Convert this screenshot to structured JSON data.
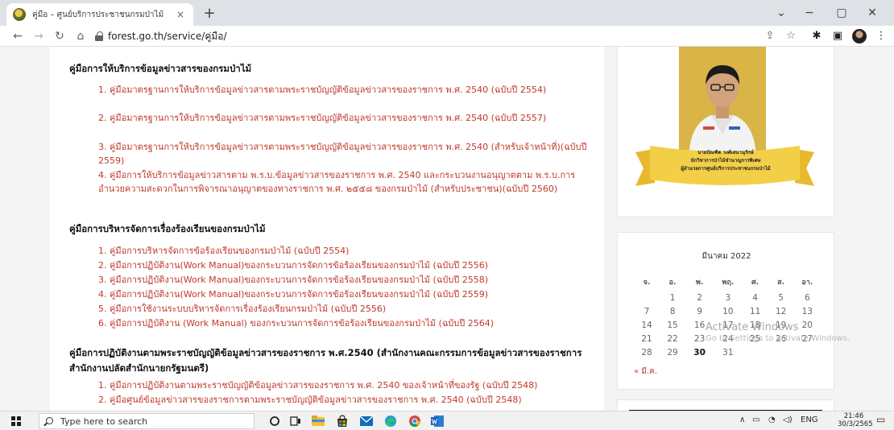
{
  "browser": {
    "tab_title": "คู่มือ – ศูนย์บริการประชาชนกรมป่าไม้",
    "tab_close": "×",
    "new_tab": "+",
    "win_min": "−",
    "win_max": "▢",
    "win_close": "✕",
    "win_chevron": "⌄",
    "back": "←",
    "forward": "→",
    "reload": "↻",
    "home": "⌂",
    "url": "forest.go.th/service/คู่มือ/",
    "share": "⇪",
    "star": "☆",
    "extensions": "✱",
    "sidepanel": "▣",
    "menu": "⋮"
  },
  "content": {
    "sections": [
      {
        "title": "คู่มือการให้บริการข้อมูลข่าวสารของกรมป่าไม้",
        "items": [
          "1. คู่มือมาตรฐานการให้บริการข้อมูลข่าวสารตามพระราชบัญญัติข้อมูลข่าวสารของราชการ พ.ศ. 2540 (ฉบับปี 2554)",
          "2. คู่มือมาตรฐานการให้บริการข้อมูลข่าวสารตามพระราชบัญญัติข้อมูลข่าวสารของราชการ พ.ศ. 2540 (ฉบับปี 2557)",
          "3. คู่มือมาตรฐานการให้บริการข้อมูลข่าวสารตามพระราชบัญญัติข้อมูลข่าวสารของราชการ พ.ศ. 2540 (สำหรับเจ้าหน้าที่)(ฉบับปี 2559)",
          "4. คู่มือการให้บริการข้อมูลข่าวสารตาม พ.ร.บ.ข้อมูลข่าวสารของราชการ พ.ศ. 2540 และกระบวนงานอนุญาตตาม พ.ร.บ.การอำนวยความสะดวกในการพิจารณาอนุญาตของทางราชการ พ.ศ. ๒๕๕๘ ของกรมป่าไม้ (สำหรับประชาชน)(ฉบับปี 2560)"
        ]
      },
      {
        "title": "คู่มือการบริหารจัดการเรื่องร้องเรียนของกรมป่าไม้",
        "items": [
          "1. คู่มือการบริหารจัดการข้อร้องเรียนของกรมป่าไม้ (ฉบับปี 2554)",
          "2. คู่มือการปฏิบัติงาน(Work Manual)ของกระบวนการจัดการข้อร้องเรียนของกรมป่าไม้ (ฉบับปี 2556)",
          "3. คู่มือการปฏิบัติงาน(Work Manual)ของกระบวนการจัดการข้อร้องเรียนของกรมป่าไม้ (ฉบับปี 2558)",
          "4. คู่มือการปฏิบัติงาน(Work Manual)ของกระบวนการจัดการข้อร้องเรียนของกรมป่าไม้ (ฉบับปี 2559)",
          "5. คู่มือการใช้งานระบบบริหารจัดการเรื่องร้องเรียนกรมป่าไม้ (ฉบับปี 2556)",
          "6. คู่มือการปฏิบัติงาน (Work Manual) ของกระบวนการจัดการข้อร้องเรียนของกรมป่าไม้ (ฉบับปี 2564)"
        ]
      },
      {
        "title": "คู่มือการปฏิบัติงานตามพระราชบัญญัติข้อมูลข่าวสารของราชการ พ.ศ.2540 (สำนักงานคณะกรรมการข้อมูลข่าวสารของราชการ สำนักงานปลัดสำนักนายกรัฐมนตรี)",
        "items": [
          "1. คู่มือการปฏิบัติงานตามพระราชบัญญัติข้อมูลข่าวสารของราชการ พ.ศ. 2540 ของเจ้าหน้าที่ของรัฐ (ฉบับปี 2548)",
          "2. คู่มือศูนย์ข้อมูลข่าวสารของราชการตามพระราชบัญญัติข้อมูลข่าวสารของราชการ พ.ศ. 2540 (ฉบับปี 2548)"
        ]
      }
    ]
  },
  "sidebar": {
    "person": {
      "name": "นายบัณฑิต วงศ์เสนานุรักษ์",
      "position": "นักวิชาการป่าไม้ชำนาญการพิเศษ",
      "role": "ผู้อำนวยการศูนย์บริการประชาชนกรมป่าไม้"
    },
    "calendar": {
      "caption": "มีนาคม 2022",
      "weekdays": [
        "จ.",
        "อ.",
        "พ.",
        "พฤ.",
        "ศ.",
        "ส.",
        "อา."
      ],
      "weeks": [
        [
          "",
          "1",
          "2",
          "3",
          "4",
          "5",
          "6"
        ],
        [
          "7",
          "8",
          "9",
          "10",
          "11",
          "12",
          "13"
        ],
        [
          "14",
          "15",
          "16",
          "17",
          "18",
          "19",
          "20"
        ],
        [
          "21",
          "22",
          "23",
          "24",
          "25",
          "26",
          "27"
        ],
        [
          "28",
          "29",
          "30",
          "31",
          "",
          "",
          ""
        ]
      ],
      "today": "30",
      "prev_link": "« มี.ค."
    }
  },
  "watermark": {
    "title": "Activate Windows",
    "subtitle": "Go to Settings to activate Windows."
  },
  "taskbar": {
    "search_placeholder": "Type here to search",
    "language": "ENG",
    "time": "21:46",
    "date": "30/3/2565"
  },
  "colors": {
    "link": "#c0392b",
    "banner": "#f3cf48"
  }
}
